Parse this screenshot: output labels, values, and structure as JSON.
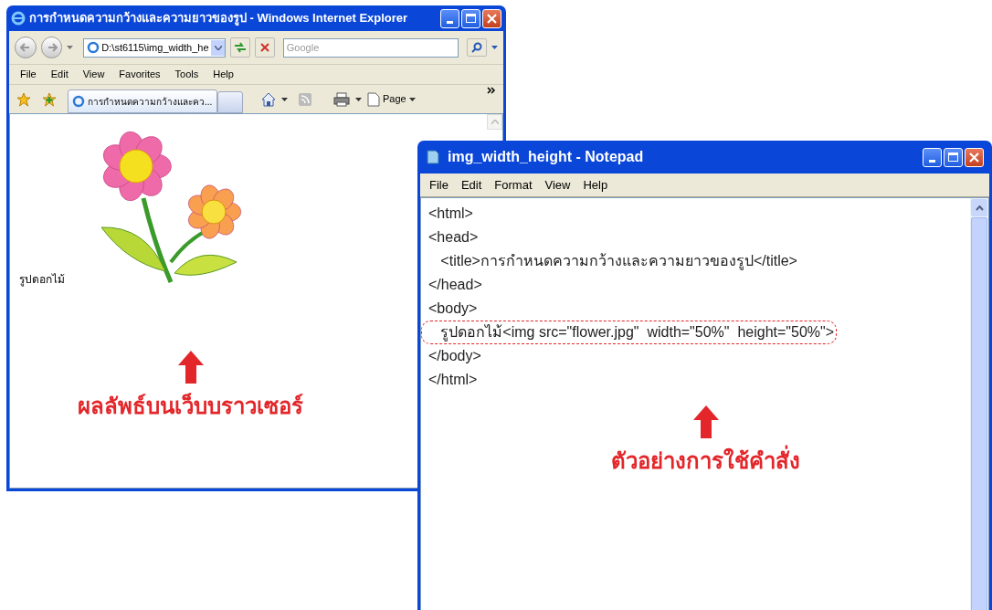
{
  "browser": {
    "title": "การกำหนดความกว้างและความยาวของรูป - Windows Internet Explorer",
    "address": "D:\\st6115\\img_width_he",
    "search": {
      "placeholder": "Google"
    },
    "menu": [
      "File",
      "Edit",
      "View",
      "Favorites",
      "Tools",
      "Help"
    ],
    "tab": {
      "label": "การกำหนดความกว้างและคว..."
    },
    "page_button": "Page",
    "page": {
      "text": "รูปดอกไม้"
    },
    "caption": "ผลลัพธ์บนเว็บบราวเซอร์"
  },
  "notepad": {
    "title": "img_width_height - Notepad",
    "menu": [
      "File",
      "Edit",
      "Format",
      "View",
      "Help"
    ],
    "lines": [
      {
        "text": "<html>",
        "highlighted": false
      },
      {
        "text": "<head>",
        "highlighted": false
      },
      {
        "text": "   <title>การกำหนดความกว้างและความยาวของรูป</title>",
        "highlighted": false
      },
      {
        "text": "</head>",
        "highlighted": false
      },
      {
        "text": "<body>",
        "highlighted": false
      },
      {
        "text": "   รูปดอกไม้<img src=\"flower.jpg\"  width=\"50%\"  height=\"50%\">",
        "highlighted": true
      },
      {
        "text": "</body>",
        "highlighted": false
      },
      {
        "text": "</html>",
        "highlighted": false
      }
    ],
    "caption": "ตัวอย่างการใช้คำสั่ง"
  }
}
